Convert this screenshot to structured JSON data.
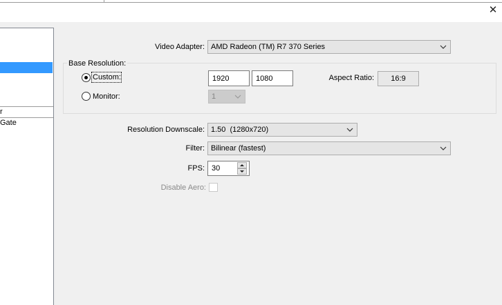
{
  "sidebar": {
    "item_r": "r",
    "item_gate": "Gate"
  },
  "video_adapter": {
    "label": "Video Adapter:",
    "value": "AMD Radeon (TM) R7 370 Series"
  },
  "base_resolution": {
    "title": "Base Resolution:",
    "custom_label": "Custom:",
    "width": "1920",
    "height": "1080",
    "aspect_label": "Aspect Ratio:",
    "aspect_value": "16:9",
    "monitor_label": "Monitor:",
    "monitor_value": "1"
  },
  "resolution_downscale": {
    "label": "Resolution Downscale:",
    "value": "1.50  (1280x720)"
  },
  "filter": {
    "label": "Filter:",
    "value": "Bilinear (fastest)"
  },
  "fps": {
    "label": "FPS:",
    "value": "30"
  },
  "disable_aero": {
    "label": "Disable Aero:"
  },
  "window": {
    "close_glyph": "✕"
  }
}
